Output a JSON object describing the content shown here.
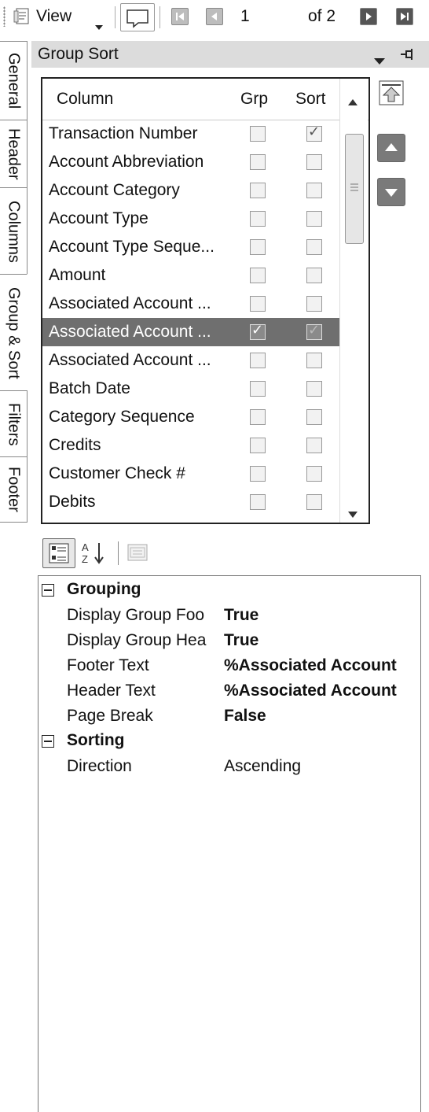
{
  "toolbar": {
    "view_label": "View",
    "current_page": "1",
    "of_label": "of 2"
  },
  "tabs": [
    "General",
    "Header",
    "Columns",
    "Group & Sort",
    "Filters",
    "Footer"
  ],
  "panel": {
    "title": "Group  Sort"
  },
  "grid": {
    "headers": {
      "column": "Column",
      "grp": "Grp",
      "sort": "Sort"
    },
    "rows": [
      {
        "label": "Transaction Number",
        "grp": false,
        "sort": true
      },
      {
        "label": "Account Abbreviation",
        "grp": false,
        "sort": false
      },
      {
        "label": "Account Category",
        "grp": false,
        "sort": false
      },
      {
        "label": "Account Type",
        "grp": false,
        "sort": false
      },
      {
        "label": "Account Type Seque...",
        "grp": false,
        "sort": false
      },
      {
        "label": "Amount",
        "grp": false,
        "sort": false
      },
      {
        "label": "Associated Account ...",
        "grp": false,
        "sort": false
      },
      {
        "label": "Associated Account ...",
        "grp": true,
        "sort": true,
        "selected": true
      },
      {
        "label": "Associated Account ...",
        "grp": false,
        "sort": false
      },
      {
        "label": "Batch Date",
        "grp": false,
        "sort": false
      },
      {
        "label": "Category Sequence",
        "grp": false,
        "sort": false
      },
      {
        "label": "Credits",
        "grp": false,
        "sort": false
      },
      {
        "label": "Customer Check #",
        "grp": false,
        "sort": false
      },
      {
        "label": "Debits",
        "grp": false,
        "sort": false
      }
    ]
  },
  "properties": {
    "grouping_title": "Grouping",
    "grouping": [
      {
        "name": "Display Group Foo",
        "value": "True",
        "bold": true
      },
      {
        "name": "Display Group Hea",
        "value": "True",
        "bold": true
      },
      {
        "name": "Footer Text",
        "value": "%Associated Account",
        "bold": true
      },
      {
        "name": "Header Text",
        "value": "%Associated Account",
        "bold": true
      },
      {
        "name": "Page Break",
        "value": "False",
        "bold": true
      }
    ],
    "sorting_title": "Sorting",
    "sorting": [
      {
        "name": "Direction",
        "value": "Ascending",
        "bold": false
      }
    ]
  },
  "icons": [
    "grip-icon",
    "view-icon",
    "dropdown-arrow-icon",
    "comment-icon",
    "first-page-icon",
    "previous-page-icon",
    "next-page-icon",
    "last-page-icon",
    "pin-icon",
    "move-top-icon",
    "move-up-icon",
    "move-down-icon",
    "categorized-icon",
    "sort-az-icon",
    "property-pages-icon",
    "collapse-icon"
  ]
}
